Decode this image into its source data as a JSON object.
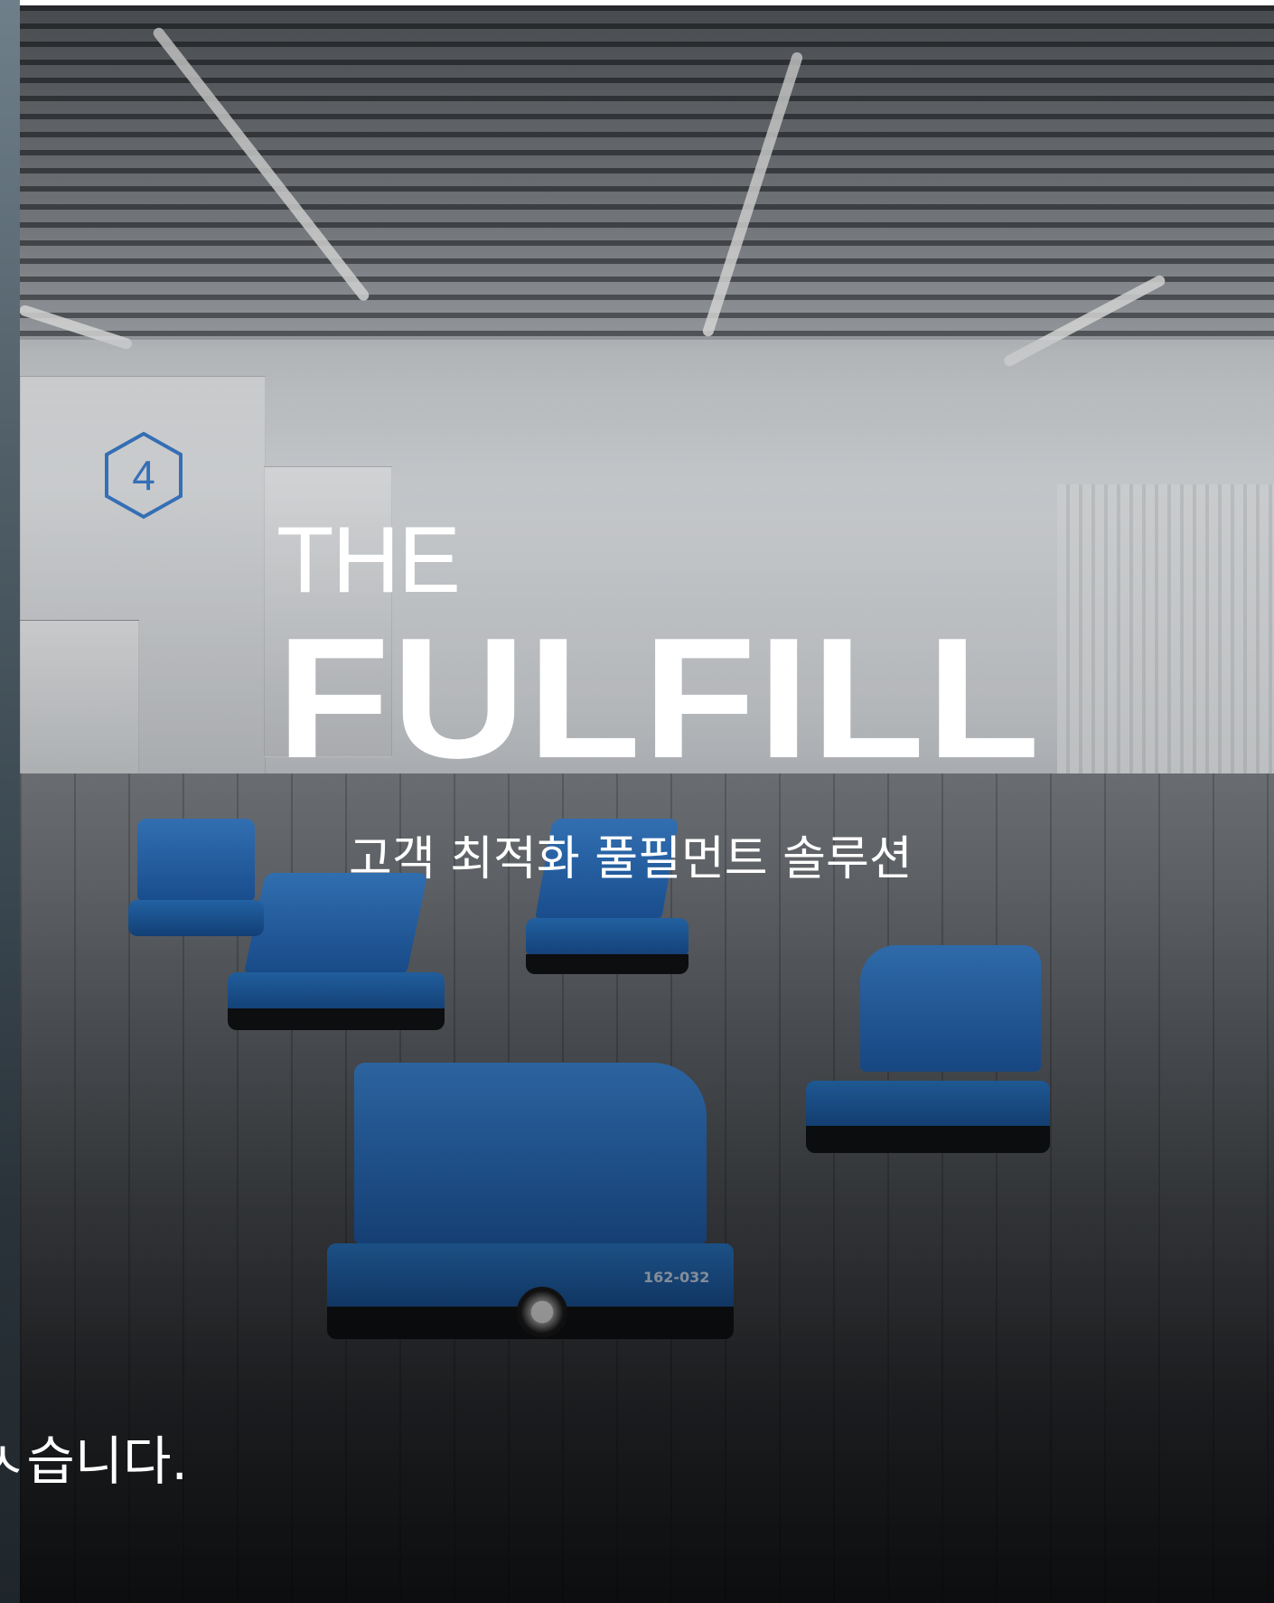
{
  "carousel": {
    "previous_slide": {
      "caption_fragment": "ㅅ습니다."
    },
    "current_slide": {
      "hero": {
        "prefix": "THE",
        "title": "FULFILL",
        "subtitle": "고객 최적화 풀필먼트 솔루션"
      },
      "photo": {
        "robot_id": "162-032",
        "station_number": "4"
      }
    }
  },
  "colors": {
    "hero_text": "#ffffff",
    "robot_blue": "#2a78c8",
    "badge_blue": "#3c7fd0"
  }
}
